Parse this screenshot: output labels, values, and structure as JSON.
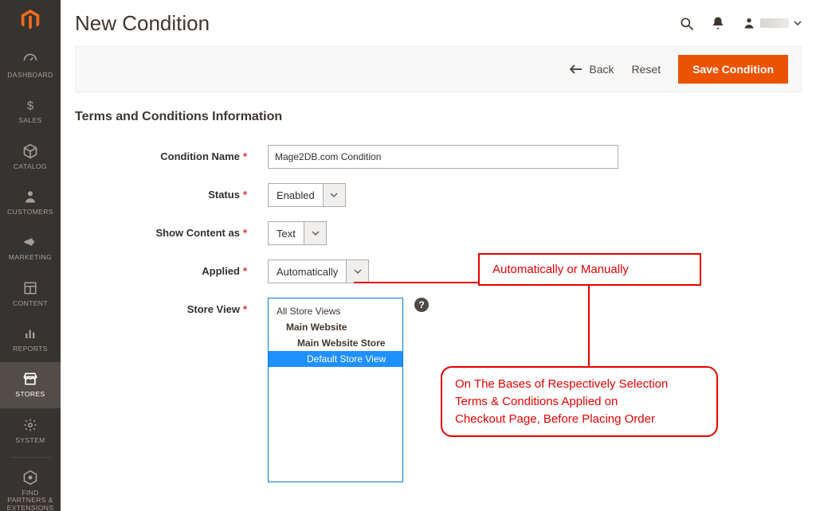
{
  "sidebar": {
    "items": [
      {
        "label": "DASHBOARD"
      },
      {
        "label": "SALES"
      },
      {
        "label": "CATALOG"
      },
      {
        "label": "CUSTOMERS"
      },
      {
        "label": "MARKETING"
      },
      {
        "label": "CONTENT"
      },
      {
        "label": "REPORTS"
      },
      {
        "label": "STORES"
      },
      {
        "label": "SYSTEM"
      },
      {
        "label": "FIND PARTNERS & EXTENSIONS"
      }
    ]
  },
  "header": {
    "page_title": "New Condition"
  },
  "actions": {
    "back": "Back",
    "reset": "Reset",
    "save": "Save Condition"
  },
  "form": {
    "section_title": "Terms and Conditions Information",
    "condition_name": {
      "label": "Condition Name",
      "value": "Mage2DB.com Condition"
    },
    "status": {
      "label": "Status",
      "value": "Enabled"
    },
    "show_content_as": {
      "label": "Show Content as",
      "value": "Text"
    },
    "applied": {
      "label": "Applied",
      "value": "Automatically"
    },
    "store_view": {
      "label": "Store View",
      "options": [
        {
          "label": "All Store Views",
          "indent": 0,
          "selected": false
        },
        {
          "label": "Main Website",
          "indent": 1,
          "selected": false
        },
        {
          "label": "Main Website Store",
          "indent": 2,
          "selected": false
        },
        {
          "label": "Default Store View",
          "indent": 3,
          "selected": true
        }
      ]
    }
  },
  "annotations": {
    "box1": "Automatically or Manually",
    "box2_line1": "On The Bases of Respectively Selection",
    "box2_line2": "Terms & Conditions Applied on",
    "box2_line3": "Checkout Page, Before Placing Order"
  },
  "colors": {
    "accent": "#eb5202",
    "annotation": "#e60000",
    "link": "#007bdb"
  }
}
